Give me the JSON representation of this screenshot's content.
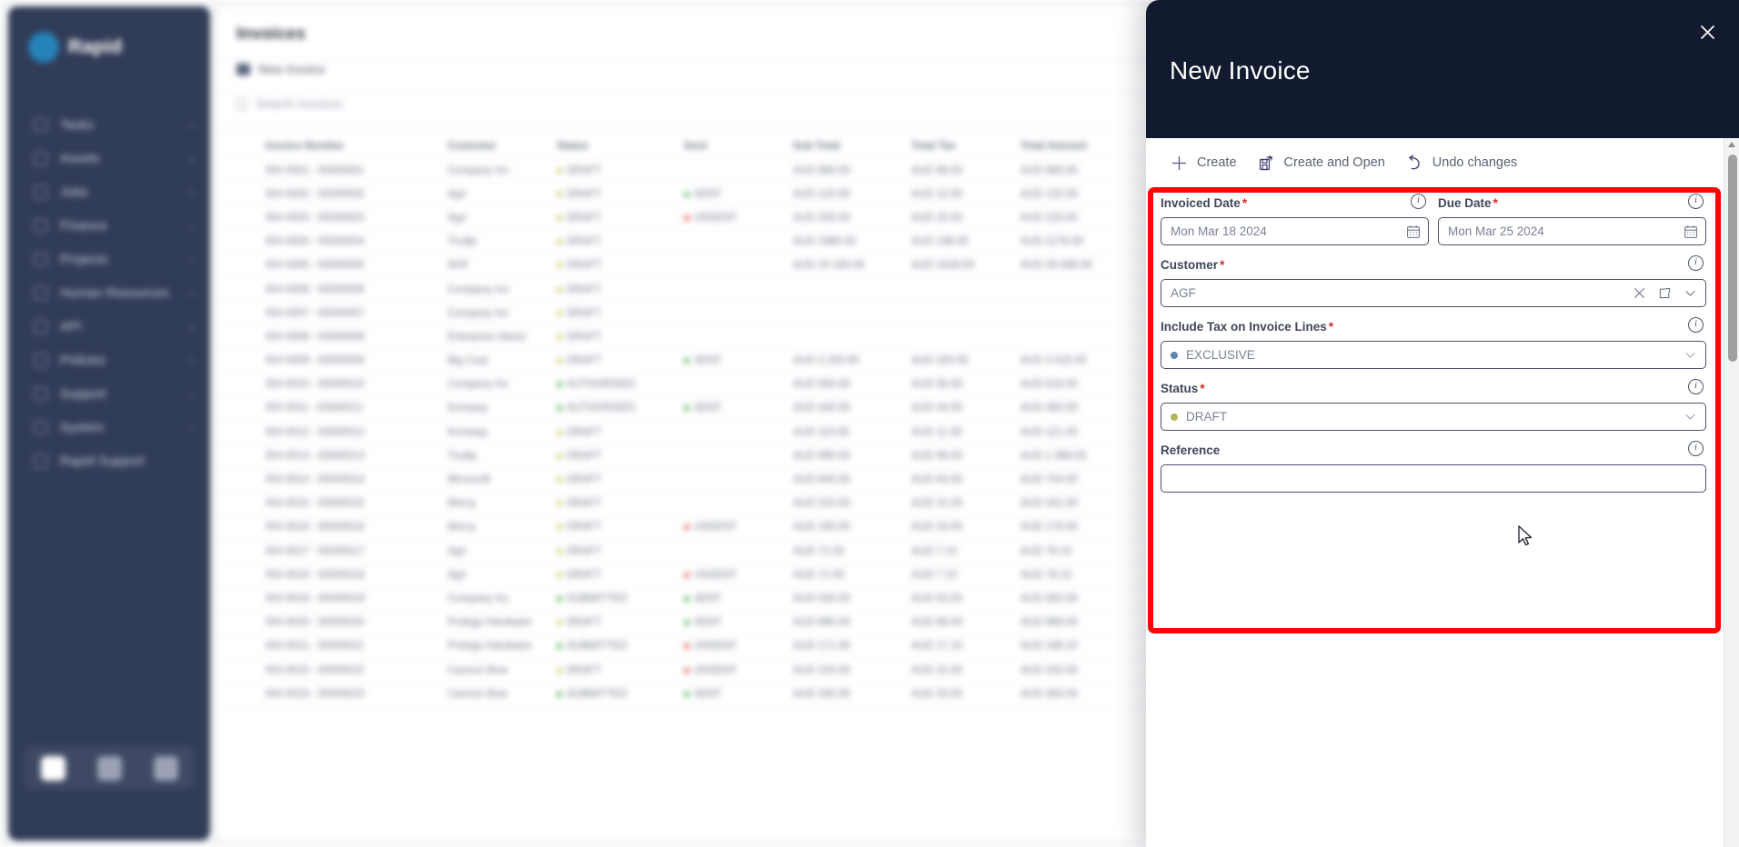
{
  "background": {
    "sidebar": {
      "logo_text": "Rapid",
      "items": [
        {
          "label": "Tasks",
          "chevron": "›"
        },
        {
          "label": "Assets",
          "chevron": "›"
        },
        {
          "label": "Jobs",
          "chevron": "›"
        },
        {
          "label": "Finance",
          "chevron": "›"
        },
        {
          "label": "Projects",
          "chevron": "›"
        },
        {
          "label": "Human Resources",
          "chevron": "›"
        },
        {
          "label": "API",
          "chevron": "›"
        },
        {
          "label": "Policies",
          "chevron": "›"
        },
        {
          "label": "Support",
          "chevron": "›"
        },
        {
          "label": "System",
          "chevron": "›"
        },
        {
          "label": "Rapid Support",
          "chevron": ""
        }
      ],
      "bottom_buttons": [
        "dashboard-icon",
        "reports-icon",
        "mail-icon"
      ]
    },
    "main": {
      "title": "Invoices",
      "new_action_label": "New Invoice",
      "search_placeholder": "Search Invoices",
      "table": {
        "columns": [
          "",
          "Invoice Number",
          "Customer",
          "Status",
          "Sent",
          "Sub Total",
          "Total Tax",
          "Total Amount"
        ],
        "rows": [
          [
            "",
            "INV-0001 : 00000001",
            "Company Inc",
            "DRAFT",
            "",
            "AUD 880.00",
            "AUD 88.00",
            "AUD 968.00"
          ],
          [
            "",
            "INV-0002 : 00000002",
            "Agri",
            "DRAFT",
            "SENT",
            "AUD 120.00",
            "AUD 12.00",
            "AUD 132.00"
          ],
          [
            "",
            "INV-0003 : 00000003",
            "Agri",
            "DRAFT",
            "UNSENT",
            "AUD 200.00",
            "AUD 20.00",
            "AUD 220.00"
          ],
          [
            "",
            "INV-0004 : 00000004",
            "Trudip",
            "DRAFT",
            "",
            "AUD 1980.00",
            "AUD 198.00",
            "AUD 2178.00"
          ],
          [
            "",
            "INV-0005 : 00000005",
            "AGF",
            "DRAFT",
            "",
            "AUD 24 180.00",
            "AUD 2418.00",
            "AUD 26 598.00"
          ],
          [
            "",
            "INV-0006 : 00000006",
            "Company Inc",
            "DRAFT",
            "",
            "",
            "",
            ""
          ],
          [
            "",
            "INV-0007 : 00000007",
            "Company Inc",
            "DRAFT",
            "",
            "",
            "",
            ""
          ],
          [
            "",
            "INV-0008 : 00000008",
            "Enterprise Name",
            "DRAFT",
            "",
            "",
            "",
            ""
          ],
          [
            "",
            "INV-0009 : 00000009",
            "Big Corp",
            "DRAFT",
            "SENT",
            "AUD 3 200.00",
            "AUD 320.00",
            "AUD 3 520.00"
          ],
          [
            "",
            "INV-0010 : 00000010",
            "Company Inc",
            "AUTHORISED",
            "",
            "AUD 560.00",
            "AUD 56.00",
            "AUD 616.00"
          ],
          [
            "",
            "INV-0011 : 00000011",
            "Kemway",
            "AUTHORISED",
            "SENT",
            "AUD 440.00",
            "AUD 44.00",
            "AUD 484.00"
          ],
          [
            "",
            "INV-0012 : 00000012",
            "Kemway",
            "DRAFT",
            "",
            "AUD 110.00",
            "AUD 11.00",
            "AUD 121.00"
          ],
          [
            "",
            "INV-0013 : 00000013",
            "Trudip",
            "DRAFT",
            "",
            "AUD 990.00",
            "AUD 99.00",
            "AUD 1 089.00"
          ],
          [
            "",
            "INV-0014 : 00000014",
            "Microsoft",
            "DRAFT",
            "",
            "AUD 640.00",
            "AUD 64.00",
            "AUD 704.00"
          ],
          [
            "",
            "INV-0015 : 00000015",
            "Mercy",
            "DRAFT",
            "",
            "AUD 310.00",
            "AUD 31.00",
            "AUD 341.00"
          ],
          [
            "",
            "INV-0016 : 00000016",
            "Mercy",
            "DRAFT",
            "UNSENT",
            "AUD 160.00",
            "AUD 16.00",
            "AUD 176.00"
          ],
          [
            "",
            "INV-0017 : 00000017",
            "Agri",
            "DRAFT",
            "",
            "AUD 71.00",
            "AUD 7.10",
            "AUD 78.10"
          ],
          [
            "",
            "INV-0018 : 00000018",
            "Agri",
            "DRAFT",
            "UNSENT",
            "AUD 71.00",
            "AUD 7.10",
            "AUD 78.10"
          ],
          [
            "",
            "INV-0019 : 00000019",
            "Company Inc",
            "SUBMITTED",
            "SENT",
            "AUD 530.00",
            "AUD 53.00",
            "AUD 583.00"
          ],
          [
            "",
            "INV-0020 : 00000020",
            "Prolego Hardware",
            "DRAFT",
            "SENT",
            "AUD 880.00",
            "AUD 88.00",
            "AUD 968.00"
          ],
          [
            "",
            "INV-0021 : 00000021",
            "Prolego Hardware",
            "SUBMITTED",
            "UNSENT",
            "AUD 171.00",
            "AUD 17.10",
            "AUD 188.10"
          ],
          [
            "",
            "INV-0022 : 00000022",
            "Cannon Bow",
            "DRAFT",
            "UNSENT",
            "AUD 220.00",
            "AUD 22.00",
            "AUD 242.00"
          ],
          [
            "",
            "INV-0023 : 00000023",
            "Cannon Bow",
            "SUBMITTED",
            "SENT",
            "AUD 330.00",
            "AUD 33.00",
            "AUD 363.00"
          ]
        ]
      }
    }
  },
  "drawer": {
    "title": "New Invoice",
    "close_icon": "close-icon",
    "toolbar": [
      {
        "label": "Create",
        "icon": "plus-icon"
      },
      {
        "label": "Create and Open",
        "icon": "save-and-open-icon"
      },
      {
        "label": "Undo changes",
        "icon": "undo-icon"
      }
    ],
    "fields": {
      "invoiced_date": {
        "label": "Invoiced Date",
        "required": true,
        "value": "Mon Mar 18 2024",
        "icon": "calendar-icon",
        "info_icon": "info-icon"
      },
      "due_date": {
        "label": "Due Date",
        "required": true,
        "value": "Mon Mar 25 2024",
        "icon": "calendar-icon",
        "info_icon": "info-icon"
      },
      "customer": {
        "label": "Customer",
        "required": true,
        "value": "AGF",
        "icons": [
          "clear-icon",
          "open-external-icon",
          "chevron-down-icon"
        ],
        "info_icon": "info-icon"
      },
      "include_tax": {
        "label": "Include Tax on Invoice Lines",
        "required": true,
        "value": "EXCLUSIVE",
        "dot_color": "#5e86b0",
        "icon": "chevron-down-icon",
        "info_icon": "info-icon"
      },
      "status": {
        "label": "Status",
        "required": true,
        "value": "DRAFT",
        "dot_color": "#b6b457",
        "icon": "chevron-down-icon",
        "info_icon": "info-icon"
      },
      "reference": {
        "label": "Reference",
        "required": false,
        "value": "",
        "info_icon": "info-icon"
      }
    },
    "required_marker": "*"
  },
  "colors": {
    "drawer_header_bg": "#111a2e",
    "highlight_border": "#fb0505",
    "sidebar_bg": "#2b3652",
    "field_border": "#485169",
    "label_text": "#3f4759",
    "value_text": "#7b8295"
  }
}
